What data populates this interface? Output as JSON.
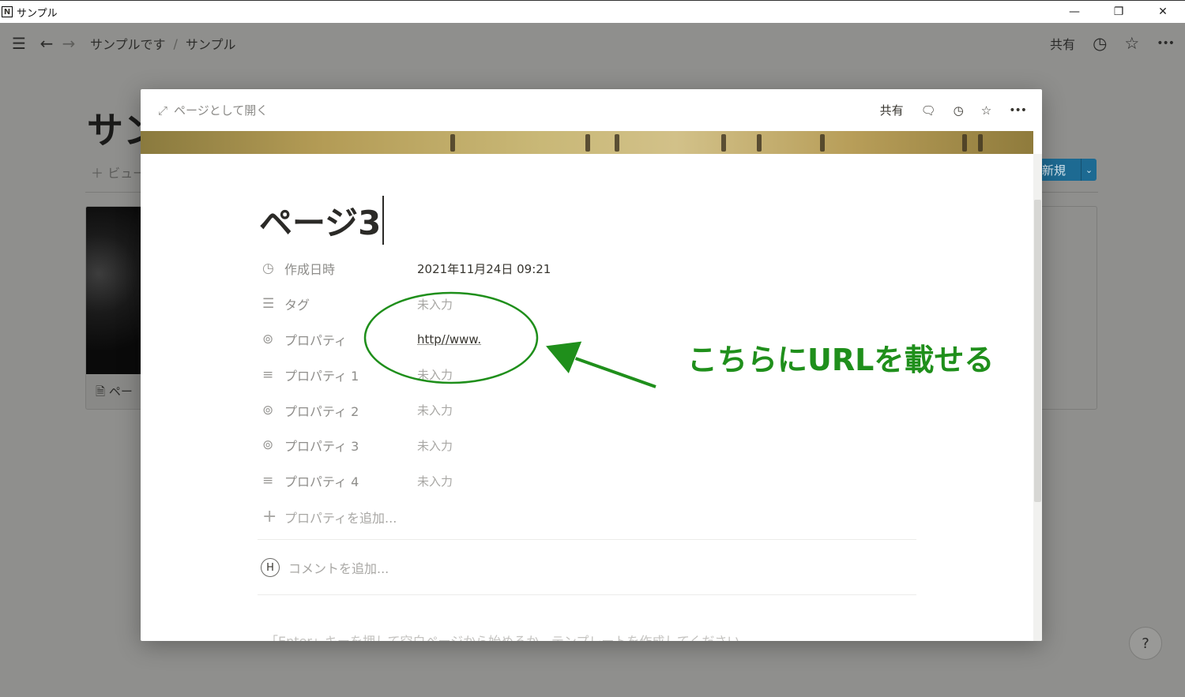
{
  "window": {
    "title": "サンプル",
    "app_icon_letter": "N",
    "minimize": "—",
    "restore": "❐",
    "close": "✕"
  },
  "topbar": {
    "menu_icon": "☰",
    "back_icon": "←",
    "forward_icon": "→",
    "breadcrumb": [
      "サンプルです",
      "サンプル"
    ],
    "breadcrumb_sep": "/",
    "share_label": "共有",
    "history_icon": "◷",
    "favorite_icon": "☆",
    "more_icon": "•••"
  },
  "background_page": {
    "title": "サン",
    "view_label": "＋ ビュー",
    "new_button": "新規",
    "new_dropdown": "⌄",
    "card_caption": "🗎 ペー"
  },
  "modal": {
    "open_as_page_icon": "⤢",
    "open_as_page": "ページとして開く",
    "share_label": "共有",
    "comment_icon": "🗨",
    "history_icon": "◷",
    "favorite_icon": "☆",
    "more_icon": "•••",
    "page_title": "ページ3",
    "properties": [
      {
        "icon": "◷",
        "icon_name": "clock-icon",
        "name": "作成日時",
        "value": "2021年11月24日 09:21",
        "state": "filled"
      },
      {
        "icon": "☰",
        "icon_name": "list-icon",
        "name": "タグ",
        "value": "未入力",
        "state": "empty"
      },
      {
        "icon": "⊚",
        "icon_name": "link-icon",
        "name": "プロパティ",
        "value": "http//www.",
        "state": "link"
      },
      {
        "icon": "≡",
        "icon_name": "text-icon",
        "name": "プロパティ 1",
        "value": "未入力",
        "state": "empty"
      },
      {
        "icon": "⊚",
        "icon_name": "link-icon",
        "name": "プロパティ 2",
        "value": "未入力",
        "state": "empty"
      },
      {
        "icon": "⊚",
        "icon_name": "link-icon",
        "name": "プロパティ 3",
        "value": "未入力",
        "state": "empty"
      },
      {
        "icon": "≡",
        "icon_name": "text-icon",
        "name": "プロパティ 4",
        "value": "未入力",
        "state": "empty"
      }
    ],
    "add_property": "プロパティを追加...",
    "add_property_icon": "+",
    "comment_avatar": "H",
    "comment_placeholder": "コメントを追加...",
    "body_hint": "「Enter」キーを押して空白ページから始めるか、テンプレートを作成してください"
  },
  "annotation": {
    "text": "こちらにURLを載せる",
    "color": "#1f8f1b"
  },
  "help": {
    "label": "?"
  }
}
